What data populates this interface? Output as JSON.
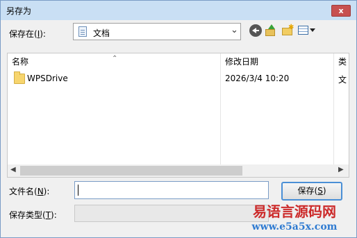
{
  "window": {
    "title": "另存为",
    "close_label": "x"
  },
  "location": {
    "label_prefix": "保存在(",
    "label_key": "I",
    "label_suffix": "):",
    "current": "文档",
    "icon": "document-icon"
  },
  "toolbar": {
    "icons": [
      "back-icon",
      "up-folder-icon",
      "new-folder-icon",
      "view-menu-icon"
    ]
  },
  "file_list": {
    "columns": [
      "名称",
      "修改日期",
      "类"
    ],
    "rows": [
      {
        "name": "WPSDrive",
        "modified": "2026/3/4 10:20",
        "type": "文",
        "icon": "folder-icon"
      }
    ]
  },
  "filename": {
    "label_prefix": "文件名(",
    "label_key": "N",
    "label_suffix": "):",
    "value": ""
  },
  "filetype": {
    "label_prefix": "保存类型(",
    "label_key": "T",
    "label_suffix": "):",
    "value": ""
  },
  "buttons": {
    "save_prefix": "保存(",
    "save_key": "S",
    "save_suffix": ")"
  },
  "watermark": {
    "cn": "易语言源码网",
    "url": "www.e5a5x.com"
  },
  "colors": {
    "title_bar": "#c9dff4",
    "close": "#c75050",
    "watermark_cn": "#cc2a2a",
    "watermark_url": "#2f7bd1"
  }
}
